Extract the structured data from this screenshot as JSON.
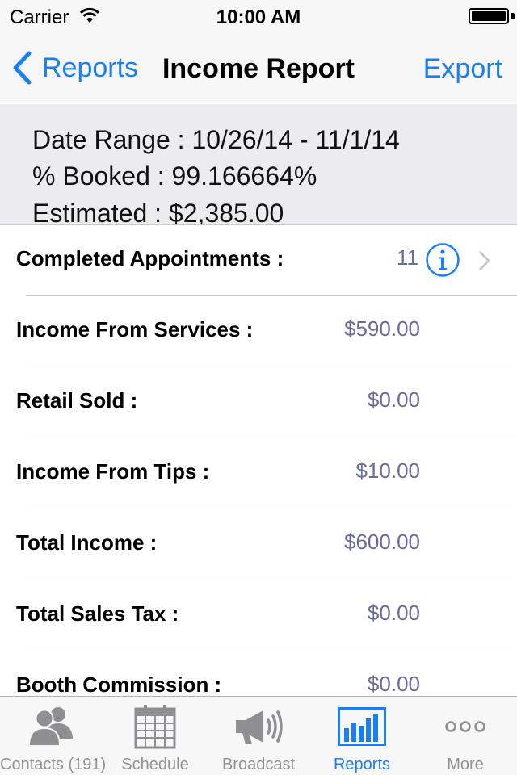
{
  "status_bar": {
    "carrier": "Carrier",
    "time": "10:00 AM",
    "battery_level": 1.0
  },
  "nav": {
    "back_label": "Reports",
    "title": "Income Report",
    "export_label": "Export"
  },
  "summary": {
    "date_range": "Date Range : 10/26/14 - 11/1/14",
    "booked": "% Booked : 99.166664%",
    "estimated": "Estimated : $2,385.00"
  },
  "rows": [
    {
      "label": "Completed Appointments :",
      "value": "11"
    },
    {
      "label": "Income From Services :",
      "value": "$590.00"
    },
    {
      "label": "Retail Sold :",
      "value": "$0.00"
    },
    {
      "label": "Income From Tips :",
      "value": "$10.00"
    },
    {
      "label": "Total Income :",
      "value": "$600.00"
    },
    {
      "label": "Total Sales Tax :",
      "value": "$0.00"
    },
    {
      "label": "Booth Commission :",
      "value": "$0.00"
    }
  ],
  "tabs": [
    {
      "label": "Contacts (191)",
      "icon": "contacts-icon"
    },
    {
      "label": "Schedule",
      "icon": "calendar-icon"
    },
    {
      "label": "Broadcast",
      "icon": "megaphone-icon"
    },
    {
      "label": "Reports",
      "icon": "bar-chart-icon",
      "active": true
    },
    {
      "label": "More",
      "icon": "more-icon"
    }
  ],
  "colors": {
    "accent": "#1a7ff0",
    "value_text": "#6a6a9b",
    "tab_inactive": "#929292"
  }
}
